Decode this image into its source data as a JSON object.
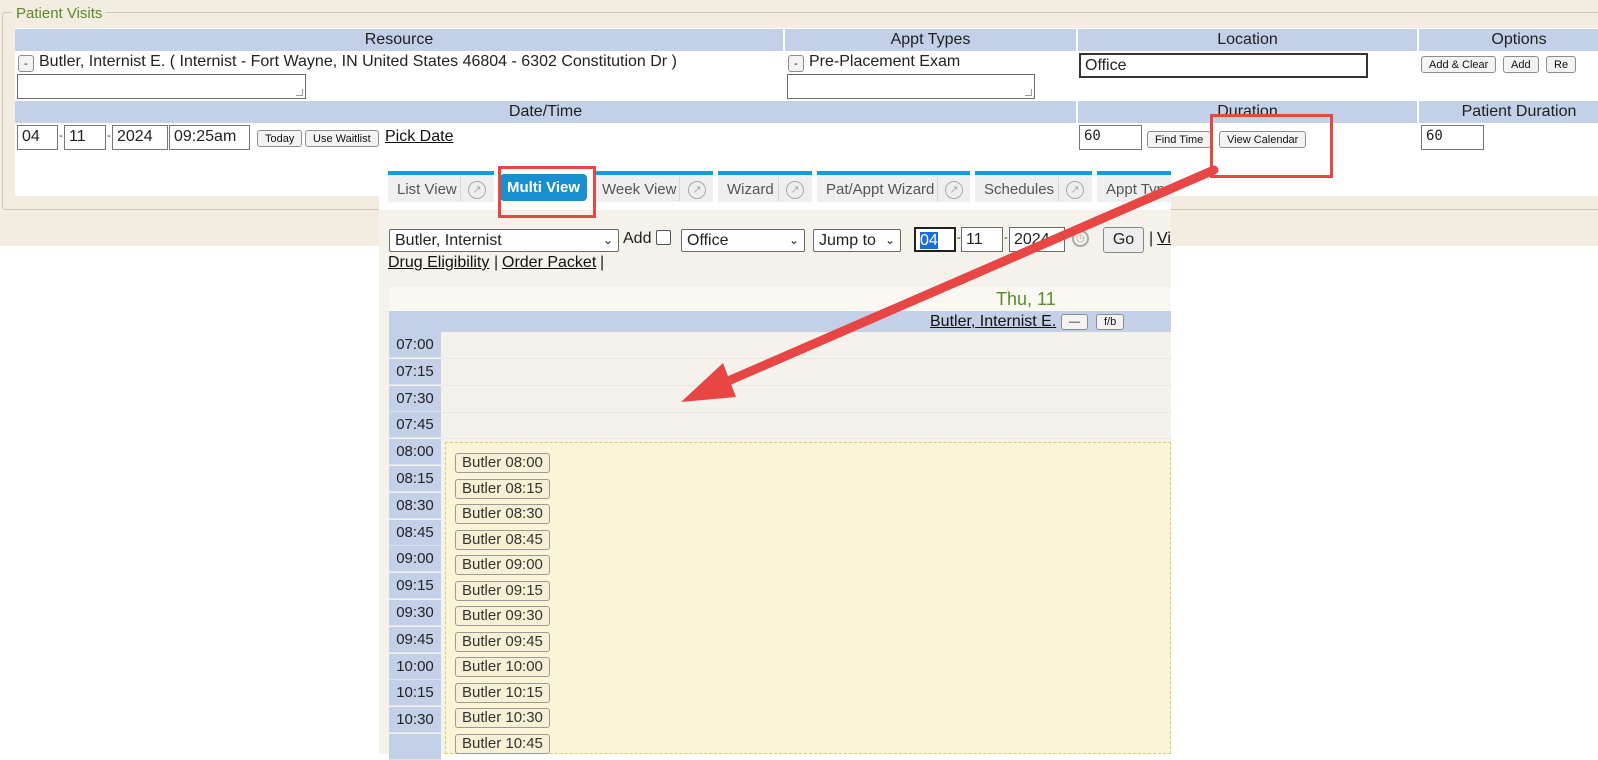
{
  "patient_visits": {
    "legend": "Patient Visits",
    "headers": {
      "resource": "Resource",
      "appt_types": "Appt Types",
      "location": "Location",
      "options": "Options",
      "date_time": "Date/Time",
      "duration": "Duration",
      "patient_duration": "Patient Duration"
    },
    "resource_minus": "-",
    "resource_text": "Butler, Internist E. ( Internist - Fort Wayne, IN United States 46804 - 6302 Constitution Dr )",
    "appt_minus": "-",
    "appt_text": "Pre-Placement Exam",
    "location_value": "Office",
    "options_buttons": [
      "Add & Clear",
      "Add",
      "Re"
    ],
    "date": {
      "month": "04",
      "day": "11",
      "year": "2024",
      "time": "09:25am"
    },
    "today_label": "Today",
    "waitlist_label": "Use Waitlist",
    "pick_date_label": "Pick Date",
    "duration_value": "60",
    "find_time_label": "Find Time",
    "view_calendar_label": "View Calendar",
    "patient_duration_value": "60"
  },
  "tabs": {
    "list_view": "List View",
    "multi_view": "Multi View",
    "week_view": "Week View",
    "wizard": "Wizard",
    "pat_appt_wizard": "Pat/Appt Wizard",
    "schedules": "Schedules",
    "appt_types": "Appt Type"
  },
  "toolbar": {
    "resource_select": "Butler, Internist",
    "add_label": "Add",
    "location_select": "Office",
    "jump_select": "Jump to",
    "month": "04",
    "day": "11",
    "year": "2024",
    "go_label": "Go",
    "vi_link": "Vi",
    "drug_eligibility": "Drug Eligibility",
    "order_packet": "Order Packet",
    "pipe": "|"
  },
  "calendar": {
    "day_header": "Thu, 11",
    "resource_name": "Butler, Internist E.",
    "minimize_label": "—",
    "fb_label": "f/b",
    "times": [
      "07:00",
      "07:15",
      "07:30",
      "07:45",
      "08:00",
      "08:15",
      "08:30",
      "08:45",
      "09:00",
      "09:15",
      "09:30",
      "09:45",
      "10:00",
      "10:15",
      "10:30"
    ],
    "slots": [
      "Butler 08:00",
      "Butler 08:15",
      "Butler 08:30",
      "Butler 08:45",
      "Butler 09:00",
      "Butler 09:15",
      "Butler 09:30",
      "Butler 09:45",
      "Butler 10:00",
      "Butler 10:15",
      "Butler 10:30",
      "Butler 10:45"
    ]
  },
  "colors": {
    "annotation_red": "#e84545",
    "tab_blue": "#1a9ad6",
    "header_blue": "#c3d0e8"
  }
}
